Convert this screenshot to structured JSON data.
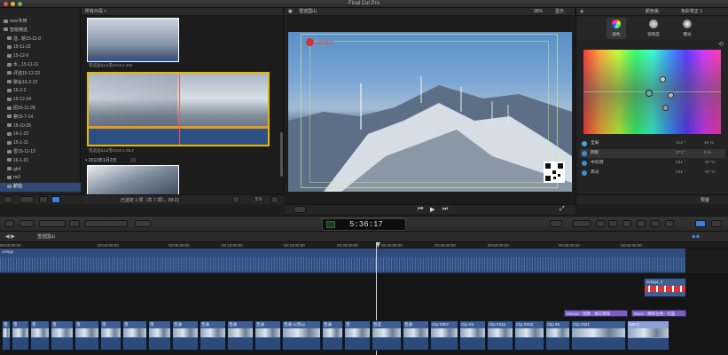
{
  "app_title": "Final Cut Pro",
  "library": {
    "items": [
      {
        "label": "mov专用",
        "selected": false
      },
      {
        "label": "智能精选",
        "selected": false
      },
      {
        "label": "选...桃15-11-9",
        "selected": false
      },
      {
        "label": "15-11-22",
        "selected": false
      },
      {
        "label": "15-12-6",
        "selected": false
      },
      {
        "label": "水...15-11-11",
        "selected": false
      },
      {
        "label": "评选15-12-22",
        "selected": false
      },
      {
        "label": "聚会16-2-12",
        "selected": false
      },
      {
        "label": "16-2-2",
        "selected": false
      },
      {
        "label": "15-12-24",
        "selected": false
      },
      {
        "label": "团15-11-28",
        "selected": false
      },
      {
        "label": "察15-7-14",
        "selected": false
      },
      {
        "label": "15-10-25",
        "selected": false
      },
      {
        "label": "16-1-22",
        "selected": false
      },
      {
        "label": "15-1-11",
        "selected": false
      },
      {
        "label": "雪15-11-13",
        "selected": false
      },
      {
        "label": "16-1-31",
        "selected": false
      },
      {
        "label": "gh4",
        "selected": false
      },
      {
        "label": "nx3",
        "selected": false
      },
      {
        "label": "航拍",
        "selected": true
      }
    ]
  },
  "browser": {
    "filter_label": "所有片段",
    "clip1_caption": "雪选国山山雪2016.1.202",
    "clip2_caption": "雪选国山山雪2016.1.25.2",
    "date_group": "2013年1月2日",
    "date_group_count": "(1)",
    "status": "已选定 1 项（共 7 项），09:21",
    "zoom_value": "5 9"
  },
  "viewer": {
    "title": "雪选国山",
    "zoom": "39%",
    "view_menu": "显示",
    "watermark": "创新智能"
  },
  "inspector": {
    "title_left": "颜色板",
    "title_right": "色彩校正 1",
    "tabs": [
      {
        "label": "颜色",
        "active": true
      },
      {
        "label": "饱和度",
        "active": false
      },
      {
        "label": "曝光",
        "active": false
      }
    ],
    "rows": [
      {
        "label": "全局",
        "value1": "212 °",
        "value2": "46 %",
        "color": "#4aa3df"
      },
      {
        "label": "阴影",
        "value1": "173 °",
        "value2": "0 %",
        "color": "#3c8fd0"
      },
      {
        "label": "中间调",
        "value1": "231 °",
        "value2": "-57 %",
        "color": "#3c8fd0"
      },
      {
        "label": "高光",
        "value1": "231 °",
        "value2": "-57 %",
        "color": "#3c8fd0"
      }
    ],
    "preset_label": "预置"
  },
  "toolbar": {
    "timecode": "5:36:17"
  },
  "timeline": {
    "project_name": "雪选国山",
    "ruler_ticks": [
      "00:00:00:00",
      "00:04:00:00",
      "00:05:00:00",
      "00:10:00:00",
      "00:15:00:00",
      "00:30:00:00",
      "00:40:00:00",
      "00:45:00:00",
      "00:50:00:00",
      "00:55:00:00",
      "00:60:00:00"
    ],
    "audio_track_label": "zelogo",
    "clip_labels": [
      "雪",
      "雪",
      "雪",
      "雪",
      "雪",
      "雪",
      "雪",
      "雪",
      "普通",
      "普通",
      "普通",
      "普通",
      "普通 山雪山",
      "普通",
      "雪",
      "普选",
      "普通",
      "Clip #307",
      "Clip #3",
      "Clip #316",
      "Clip #318",
      "Clip #3",
      "Clip #321",
      "389 C"
    ],
    "title_clips": [
      {
        "label": "zelogo_4"
      },
      {
        "label": "Mosaic - 图像 - 横向擦除"
      },
      {
        "label": "Basic - 横移左侧 - 页面"
      }
    ]
  },
  "colors": {
    "accent": "#3f7fd9",
    "clip": "#3e5f94",
    "title_clip": "#7a5fc0"
  }
}
